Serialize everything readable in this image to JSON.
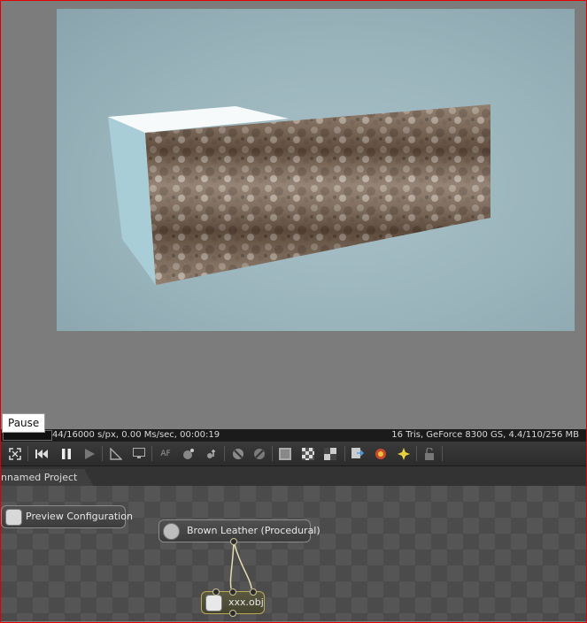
{
  "tooltip": {
    "text": "Pause"
  },
  "status": {
    "left": "44/16000 s/px, 0.00 Ms/sec, 00:00:19",
    "right": "16 Tris, GeForce 8300 GS, 4.4/110/256 MB"
  },
  "toolbar": {
    "icons": [
      "fit-view-icon",
      "rewind-icon",
      "pause-icon",
      "play-icon",
      "ruler-icon",
      "monitor-icon",
      "af-icon",
      "lighting-icon",
      "light-probe-icon",
      "sphere-icon",
      "sphere-alt-icon",
      "solid-fill-icon",
      "checker-icon",
      "checker-alt-icon",
      "export-icon",
      "render-icon",
      "effects-icon",
      "lock-icon"
    ]
  },
  "tabs": {
    "project": "Unnamed Project"
  },
  "graph": {
    "nodes": {
      "preview": "Preview Configuration",
      "material": "Brown Leather (Procedural)",
      "object": "xxx.obj"
    }
  },
  "colors": {
    "frame": "#e00000",
    "background": "#7f7f7f",
    "viewport": "#9ab4bc"
  }
}
